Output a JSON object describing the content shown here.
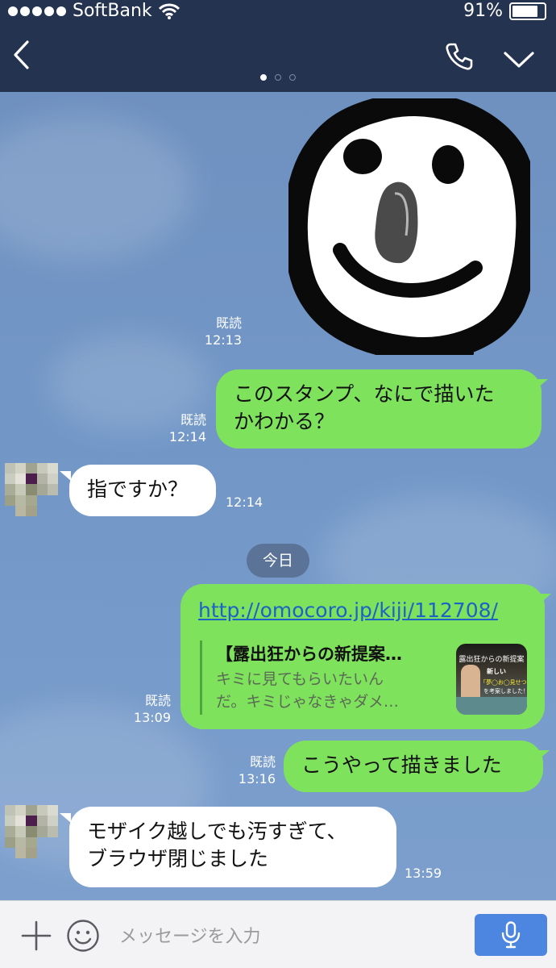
{
  "status": {
    "carrier": "SoftBank",
    "battery": "91%",
    "battery_level": 0.91
  },
  "chat": {
    "page_dots": 3,
    "messages": [
      {
        "from": "me",
        "type": "sticker",
        "read": "既読",
        "time": "12:13"
      },
      {
        "from": "me",
        "type": "text",
        "read": "既読",
        "time": "12:14",
        "lines": [
          "このスタンプ、なにで描いた",
          "かわかる？"
        ]
      },
      {
        "from": "other",
        "type": "text",
        "time": "12:14",
        "lines": [
          "指ですか？"
        ]
      },
      {
        "from": "me",
        "type": "link",
        "read": "既読",
        "time": "13:09",
        "url": "http://omocoro.jp/kiji/112708/",
        "preview_title": "【露出狂からの新提案…",
        "preview_desc": [
          "キミに見てもらいたいん",
          "だ。キミじゃなきゃダメ…"
        ],
        "thumb_text": [
          "露出狂からの新提案",
          "新しい",
          "「夢◯お◯見せつけ方」",
          "を考案しました！"
        ]
      },
      {
        "from": "me",
        "type": "text",
        "read": "既読",
        "time": "13:16",
        "lines": [
          "こうやって描きました"
        ]
      },
      {
        "from": "other",
        "type": "text",
        "time": "13:59",
        "lines": [
          "モザイク越しでも汚すぎて、",
          "ブラウザ閉じました"
        ]
      }
    ],
    "date_separator": "今日"
  },
  "input": {
    "placeholder": "メッセージを入力"
  },
  "colors": {
    "nav_bg": "#24334f",
    "bubble_me": "#7fe25c",
    "bubble_other": "#ffffff",
    "mic": "#4d86e0",
    "link": "#1b63c6"
  },
  "icons": [
    "back-chevron-icon",
    "phone-icon",
    "dropdown-chevron-icon",
    "plus-icon",
    "emoji-icon",
    "mic-icon",
    "wifi-icon",
    "battery-icon"
  ]
}
